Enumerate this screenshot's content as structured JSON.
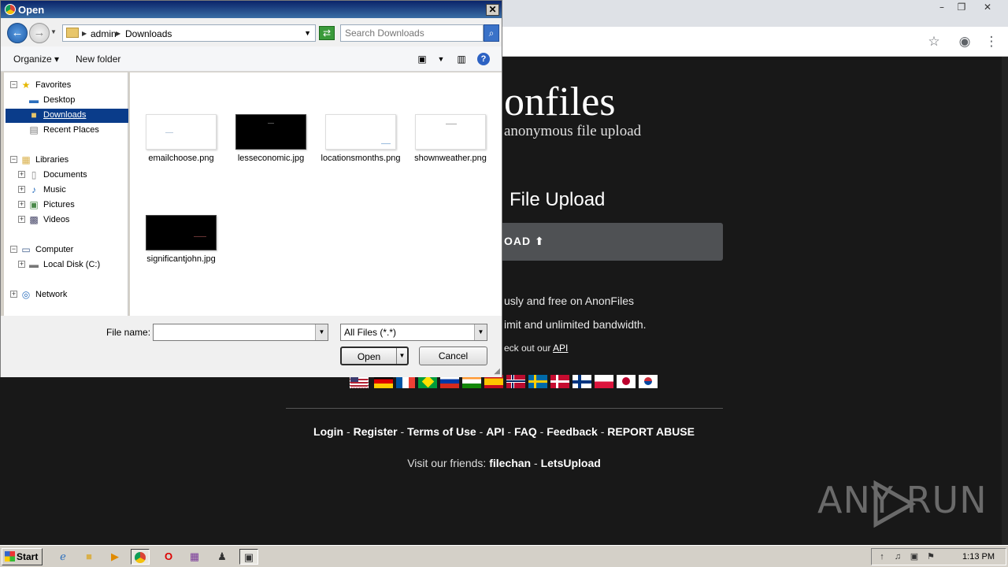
{
  "browser": {
    "site": {
      "logo": "onfiles",
      "tagline": "anonymous file upload",
      "heading": "File Upload",
      "upload_label": "OAD",
      "upload_icon": "arrow-up-circle-icon",
      "desc1": "usly and free on AnonFiles",
      "desc2": "imit and unlimited bandwidth.",
      "desc3_prefix": "eck out our ",
      "desc3_link": "API",
      "flags": [
        "us",
        "de",
        "fr",
        "br",
        "ru",
        "in",
        "es",
        "no",
        "se",
        "dk",
        "fi",
        "pl",
        "jp",
        "kr"
      ],
      "footer_links": [
        "Login",
        "Register",
        "Terms of Use",
        "API",
        "FAQ",
        "Feedback",
        "REPORT ABUSE"
      ],
      "friends_prefix": "Visit our friends:",
      "friends": [
        "filechan",
        "LetsUpload"
      ]
    },
    "watermark": "ANY  RUN"
  },
  "dialog": {
    "title": "Open",
    "breadcrumb": [
      "admin",
      "Downloads"
    ],
    "search_placeholder": "Search Downloads",
    "toolbar": {
      "organize": "Organize",
      "new_folder": "New folder"
    },
    "tree": {
      "favorites": "Favorites",
      "desktop": "Desktop",
      "downloads": "Downloads",
      "recent": "Recent Places",
      "libraries": "Libraries",
      "documents": "Documents",
      "music": "Music",
      "pictures": "Pictures",
      "videos": "Videos",
      "computer": "Computer",
      "localdisk": "Local Disk (C:)",
      "network": "Network"
    },
    "files": [
      {
        "name": "emailchoose.png",
        "thumb": "light"
      },
      {
        "name": "lesseconomic.jpg",
        "thumb": "dark"
      },
      {
        "name": "locationsmonths.png",
        "thumb": "light"
      },
      {
        "name": "shownweather.png",
        "thumb": "light"
      },
      {
        "name": "significantjohn.jpg",
        "thumb": "dark"
      }
    ],
    "file_name_label": "File name:",
    "file_name_value": "",
    "file_type": "All Files (*.*)",
    "open_label": "Open",
    "cancel_label": "Cancel"
  },
  "taskbar": {
    "start_label": "Start",
    "clock": "1:13 PM"
  },
  "colors": {
    "site_bg": "#181818",
    "upload_btn": "#4f5154",
    "selection": "#0a3c8a"
  }
}
